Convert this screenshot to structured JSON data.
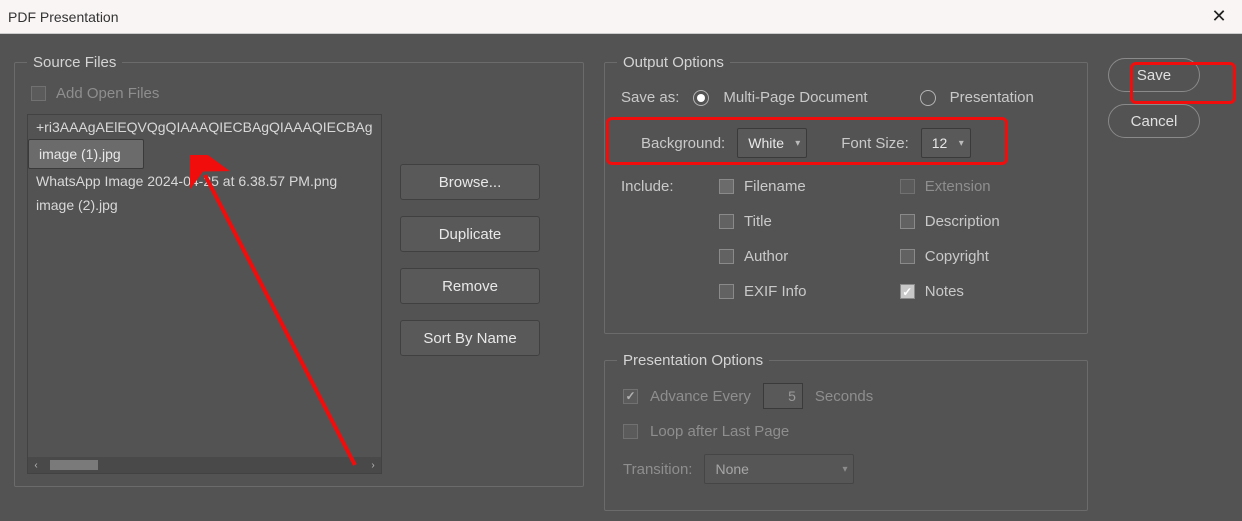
{
  "window": {
    "title": "PDF Presentation"
  },
  "source": {
    "legend": "Source Files",
    "add_open_label": "Add Open Files",
    "files": [
      "+ri3AAAgAElEQVQgQIAAAQIECBAgQIAAAQIECBAg",
      "image (1).jpg",
      "WhatsApp Image 2024-04-25 at 6.38.57 PM.png",
      "image (2).jpg"
    ],
    "buttons": {
      "browse": "Browse...",
      "duplicate": "Duplicate",
      "remove": "Remove",
      "sort": "Sort By Name"
    }
  },
  "output": {
    "legend": "Output Options",
    "save_as_label": "Save as:",
    "multi_page_label": "Multi-Page Document",
    "presentation_label": "Presentation",
    "background_label": "Background:",
    "background_value": "White",
    "font_size_label": "Font Size:",
    "font_size_value": "12",
    "include_label": "Include:",
    "filename_label": "Filename",
    "extension_label": "Extension",
    "title_label": "Title",
    "description_label": "Description",
    "author_label": "Author",
    "copyright_label": "Copyright",
    "exif_label": "EXIF Info",
    "notes_label": "Notes"
  },
  "presentation": {
    "legend": "Presentation Options",
    "advance_label": "Advance Every",
    "advance_value": "5",
    "seconds_label": "Seconds",
    "loop_label": "Loop after Last Page",
    "transition_label": "Transition:",
    "transition_value": "None"
  },
  "actions": {
    "save": "Save",
    "cancel": "Cancel"
  }
}
